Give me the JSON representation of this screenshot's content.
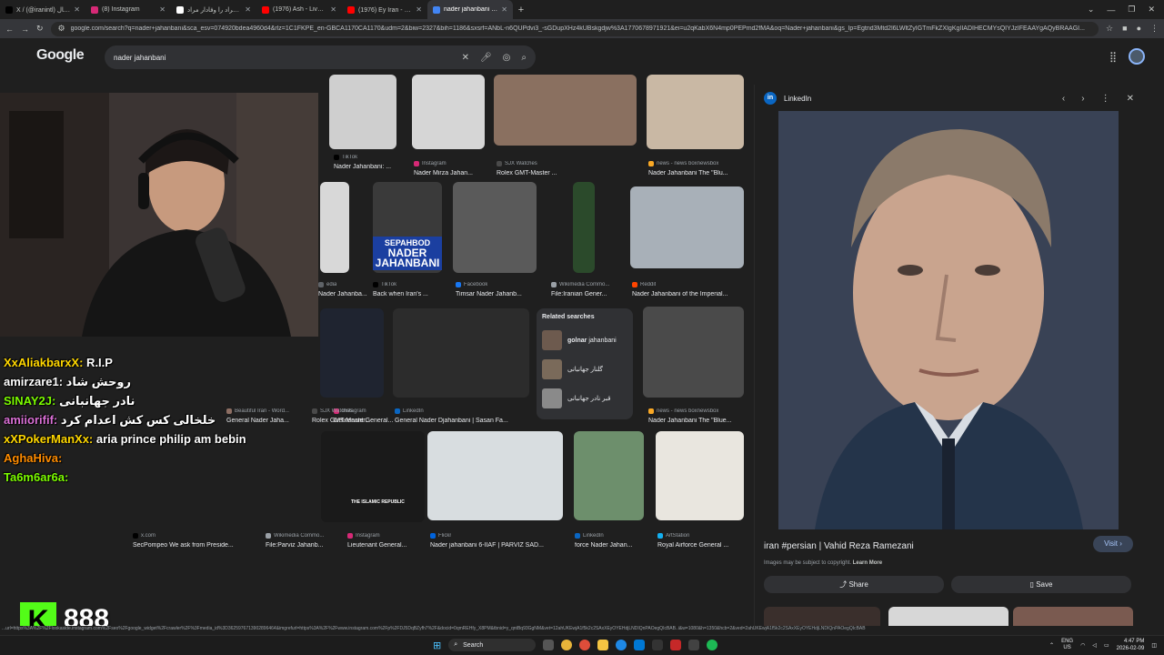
{
  "browser": {
    "tabs": [
      {
        "title": "X / (@iranintl) ایران اینترنشنال",
        "color": "#000000",
        "active": false
      },
      {
        "title": "(8) Instagram",
        "color": "#d62976",
        "active": false
      },
      {
        "title": "پیچک مراد را وفادار مراد",
        "color": "#ffffff",
        "active": false
      },
      {
        "title": "(1976) Ash - Live at Bonjuk",
        "color": "#ff0000",
        "active": false
      },
      {
        "title": "(1976) Ey Iran - ای ایران (Arash",
        "color": "#ff0000",
        "active": false
      },
      {
        "title": "nader jahanbani - Google Search",
        "color": "#4285f4",
        "active": true
      }
    ],
    "url": "google.com/search?q=nader+jahanbani&sca_esv=074920bdea4960d4&rlz=1C1FKPE_en-GBCA1170CA1170&udm=2&biw=2327&bih=1186&sxsrf=ANbL-n6QUPdvi3_-sGDupXHz4kUBskgdjw%3A1770678971921&ei=u2qKabX6N4mp0PEPmd2fMA&oq=Nader+jahanbani&gs_lp=Egtnd3Mtd2l6LWltZyIGTmFkZXIgKgIIADIHECMYsQIYJzIFEAAYgAQyBRAAGI..."
  },
  "google": {
    "logo": "Google",
    "query": "nader jahanbani"
  },
  "results": [
    {
      "caption": "Nader Jahanbani: ...",
      "source": "TikTok",
      "src_color": "#000000"
    },
    {
      "caption": "Nader Mirza Jahan...",
      "source": "Instagram",
      "src_color": "#d62976"
    },
    {
      "caption": "Rolex GMT-Master ...",
      "source": "SJX Watches",
      "src_color": "#4a4a4a"
    },
    {
      "caption": "Nader Jahanbani The \"Blu...",
      "source": "news - news boxnewsbox",
      "src_color": "#f9a825"
    },
    {
      "caption": "Nader Jahanba...",
      "source": "edia",
      "src_color": "#5f6368"
    },
    {
      "caption": "Back when Iran's ...",
      "source": "TikTok",
      "src_color": "#000000"
    },
    {
      "caption": "Timsar Nader Jahanb...",
      "source": "Facebook",
      "src_color": "#1877f2"
    },
    {
      "caption": "File:Iranian Gener...",
      "source": "Wikimedia Commo...",
      "src_color": "#9aa0a6"
    },
    {
      "caption": "Nader Jahanbani of the Imperial...",
      "source": "Reddit",
      "src_color": "#ff4500"
    },
    {
      "caption": "Lieutenant General...",
      "source": "Instagram",
      "src_color": "#d62976"
    },
    {
      "caption": "General Nader Jaha...",
      "source": "Beautiful Iran - Word...",
      "src_color": "#8d6e63"
    },
    {
      "caption": "Rolex GMT-Master...",
      "source": "SJX Watches",
      "src_color": "#4a4a4a"
    },
    {
      "caption": "General Nader Djahanbani | Sasan Fa...",
      "source": "LinkedIn",
      "src_color": "#0a66c2"
    },
    {
      "caption": "Nader Jahanbani The \"Blue...",
      "source": "news - news boxnewsbox",
      "src_color": "#f9a825"
    },
    {
      "caption": "SecPompeo We ask from Preside...",
      "source": "x.com",
      "src_color": "#000000"
    },
    {
      "caption": "File:Parviz Jahanb...",
      "source": "Wikimedia Commo...",
      "src_color": "#9aa0a6"
    },
    {
      "caption": "Lieutenant General...",
      "source": "Instagram",
      "src_color": "#d62976"
    },
    {
      "caption": "Nader jahanbani 6-IIAF | PARVIZ SAD...",
      "source": "Flickr",
      "src_color": "#0063dc"
    },
    {
      "caption": "force Nader Jahan...",
      "source": "LinkedIn",
      "src_color": "#0a66c2"
    },
    {
      "caption": "Royal Airforce General ...",
      "source": "ArtStation",
      "src_color": "#13aff0"
    }
  ],
  "poster_text": {
    "line1": "SEPAHBOD",
    "line2": "NADER",
    "line3": "JAHANBANI"
  },
  "islamic_text": "THE ISLAMIC REPUBLIC",
  "related": {
    "heading": "Related searches",
    "items": [
      {
        "bold": "golnar",
        "rest": " jahanbani"
      },
      {
        "bold": "",
        "rest": "گلنار جهانبانی"
      },
      {
        "bold": "",
        "rest": "قبر نادر جهانبانی"
      }
    ]
  },
  "overlay": {
    "chat": [
      {
        "user": "XxAliakbarxX:",
        "msg": " R.I.P",
        "color": "#ffd700"
      },
      {
        "user": "amirzare1:",
        "msg": " روحش شاد",
        "color": "#ffffff"
      },
      {
        "user": "SINAY2J:",
        "msg": " نادر جهانبانی",
        "color": "#7cfc00"
      },
      {
        "user": "amiiorifif:",
        "msg": " خلخالی کس کش اعدام کرد",
        "color": "#da70d6"
      },
      {
        "user": "xXPokerManXx:",
        "msg": " aria prince philip am bebin",
        "color": "#ffd700"
      },
      {
        "user": "AghaHiva:",
        "msg": "",
        "color": "#ff8c00"
      },
      {
        "user": "Ta6m6ar6a:",
        "msg": "",
        "color": "#7cfc00"
      }
    ],
    "kick_logo": "K",
    "viewer_count": "888"
  },
  "panel": {
    "source": "LinkedIn",
    "title": "iran #persian | Vahid Reza Ramezani",
    "visit": "Visit",
    "copyright": "Images may be subject to copyright.",
    "learn_more": "Learn More",
    "share": "Share",
    "save": "Save"
  },
  "taskbar": {
    "search": "Search",
    "lang": "ENG",
    "region": "US",
    "time": "4:47 PM",
    "date": "2026-02-09"
  },
  "status_url": "...url=https%3A%2F%2Flookaside.instagram.com%2Fseo%2Fgoogle_widget%2Fcrawler%2F%3Fmedia_id%3D3625976713902896464&imgrefurl=https%3A%2F%2Fwww.instagram.com%2Fp%2FDJ5DqBZyfh7%2F&docid=0qmREHfy_X8PM&tbnid=y_qntBq93GgNM&vet=12ahUKEwjA1f5k2c2SAxXEyOYEHdjLNDIQnPAOegQIcBAB..i&w=1080&h=1350&hcb=2&ved=2ahUKEwjA1f5k2c2SAxXEyOYEHdjLNDIQnPAOegQIcBAB"
}
